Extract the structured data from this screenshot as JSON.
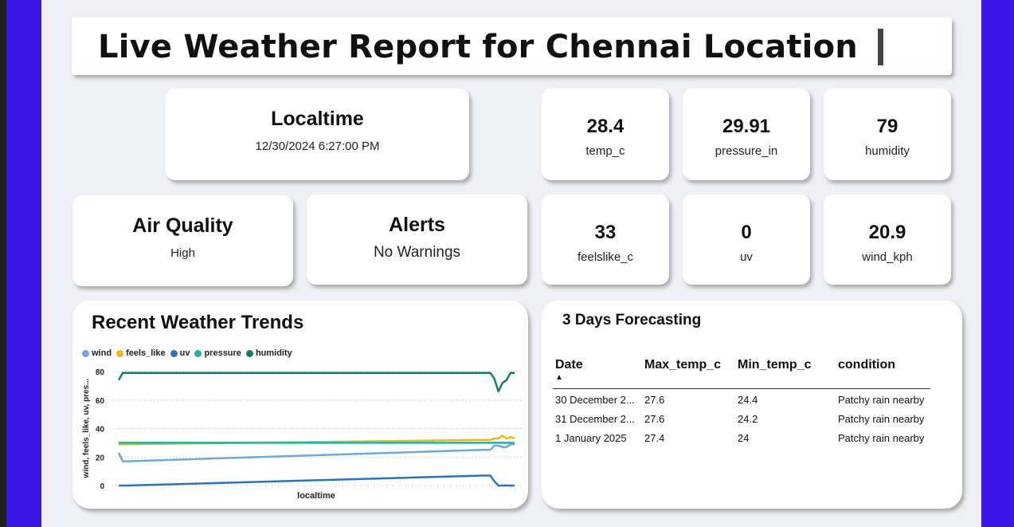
{
  "header": {
    "title": "Live Weather Report for Chennai Location"
  },
  "localtime": {
    "label": "Localtime",
    "value": "12/30/2024 6:27:00 PM"
  },
  "air_quality": {
    "label": "Air Quality",
    "value": "High"
  },
  "alerts": {
    "label": "Alerts",
    "value": "No Warnings"
  },
  "kpis": [
    {
      "value": "28.4",
      "label": "temp_c"
    },
    {
      "value": "29.91",
      "label": "pressure_in"
    },
    {
      "value": "79",
      "label": "humidity"
    },
    {
      "value": "33",
      "label": "feelslike_c"
    },
    {
      "value": "0",
      "label": "uv"
    },
    {
      "value": "20.9",
      "label": "wind_kph"
    }
  ],
  "trends": {
    "title": "Recent Weather Trends",
    "legend": [
      {
        "name": "wind",
        "color": "#6fa9d8"
      },
      {
        "name": "feels_like",
        "color": "#f2b418"
      },
      {
        "name": "uv",
        "color": "#2e73b8"
      },
      {
        "name": "pressure",
        "color": "#20b3a2"
      },
      {
        "name": "humidity",
        "color": "#168066"
      }
    ],
    "ylabel": "wind, feels_like, uv, pres...",
    "xlabel": "localtime",
    "yticks": [
      "80",
      "60",
      "40",
      "20",
      "0"
    ]
  },
  "chart_data": {
    "type": "line",
    "title": "Recent Weather Trends",
    "xlabel": "localtime",
    "ylabel": "wind, feels_like, uv, pres...",
    "ylim": [
      0,
      80
    ],
    "grid": true,
    "legend_position": "top-left",
    "x": [
      0,
      1,
      2,
      90,
      92,
      93,
      94,
      95,
      96,
      97,
      98
    ],
    "series": [
      {
        "name": "humidity",
        "color": "#168066",
        "values": [
          74,
          79,
          79,
          79,
          79,
          75,
          66,
          72,
          74,
          79,
          79
        ]
      },
      {
        "name": "feels_like",
        "color": "#f2b418",
        "values": [
          29,
          29,
          29,
          32,
          32,
          33,
          33,
          35,
          33,
          34,
          33
        ]
      },
      {
        "name": "pressure",
        "color": "#20b3a2",
        "values": [
          30,
          30,
          30,
          30,
          30,
          30,
          30,
          30,
          30,
          30,
          30
        ]
      },
      {
        "name": "wind",
        "color": "#6fa9d8",
        "values": [
          23,
          17,
          17,
          25,
          25,
          28,
          28,
          27,
          27,
          29,
          29
        ]
      },
      {
        "name": "uv",
        "color": "#2e73b8",
        "values": [
          0,
          0,
          0,
          7,
          7,
          3,
          0,
          0,
          0,
          0,
          0
        ]
      }
    ]
  },
  "forecast": {
    "title": "3 Days Forecasting",
    "columns": [
      "Date",
      "Max_temp_c",
      "Min_temp_c",
      "condition"
    ],
    "rows": [
      [
        "30 December 2...",
        "27.6",
        "24.4",
        "Patchy rain nearby"
      ],
      [
        "31 December 2...",
        "27.6",
        "24.2",
        "Patchy rain nearby"
      ],
      [
        "1 January 2025",
        "27.4",
        "24",
        "Patchy rain nearby"
      ]
    ]
  }
}
